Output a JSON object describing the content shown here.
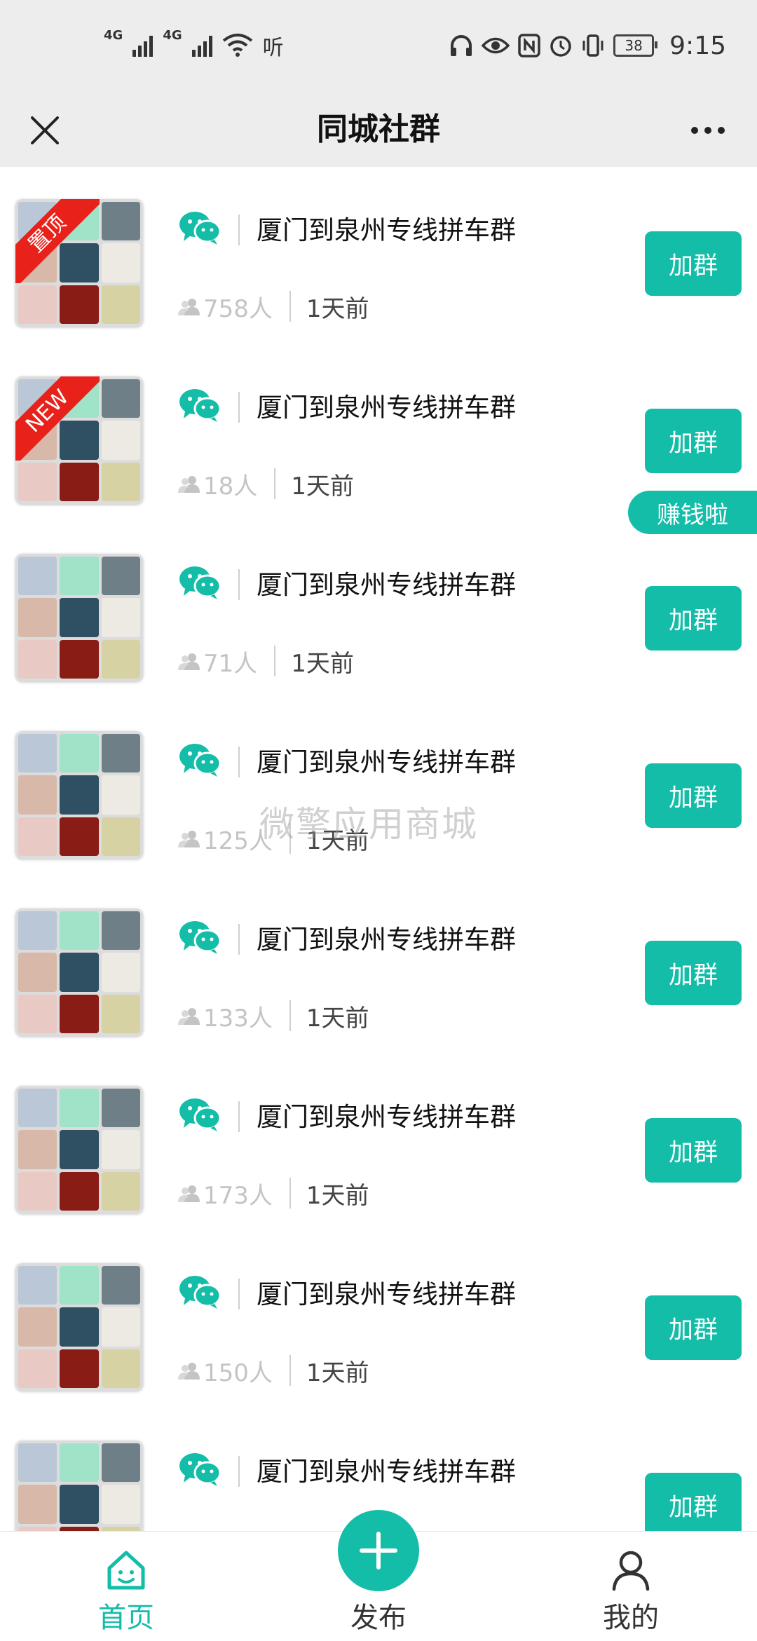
{
  "status_bar": {
    "network1": "4G",
    "network2": "4G",
    "extra": "听",
    "battery": "38",
    "time": "9:15"
  },
  "header": {
    "title": "同城社群"
  },
  "items": [
    {
      "badge": "置顶",
      "title": "厦门到泉州专线拼车群",
      "members": "758人",
      "time": "1天前",
      "button": "加群"
    },
    {
      "badge": "NEW",
      "title": "厦门到泉州专线拼车群",
      "members": "18人",
      "time": "1天前",
      "button": "加群"
    },
    {
      "badge": "",
      "title": "厦门到泉州专线拼车群",
      "members": "71人",
      "time": "1天前",
      "button": "加群"
    },
    {
      "badge": "",
      "title": "厦门到泉州专线拼车群",
      "members": "125人",
      "time": "1天前",
      "button": "加群"
    },
    {
      "badge": "",
      "title": "厦门到泉州专线拼车群",
      "members": "133人",
      "time": "1天前",
      "button": "加群"
    },
    {
      "badge": "",
      "title": "厦门到泉州专线拼车群",
      "members": "173人",
      "time": "1天前",
      "button": "加群"
    },
    {
      "badge": "",
      "title": "厦门到泉州专线拼车群",
      "members": "150人",
      "time": "1天前",
      "button": "加群"
    },
    {
      "badge": "",
      "title": "厦门到泉州专线拼车群",
      "members": "",
      "time": "",
      "button": "加群"
    }
  ],
  "float_button": "赚钱啦",
  "watermark": "微擎应用商城",
  "tabbar": {
    "home": "首页",
    "post": "发布",
    "mine": "我的"
  },
  "colors": {
    "accent": "#13bda8",
    "ribbon": "#e8211b",
    "header_bg": "#ededed"
  },
  "icons": {
    "wechat": "wechat-icon",
    "members": "people-icon",
    "home": "home-icon",
    "post": "plus-icon",
    "mine": "user-icon"
  }
}
